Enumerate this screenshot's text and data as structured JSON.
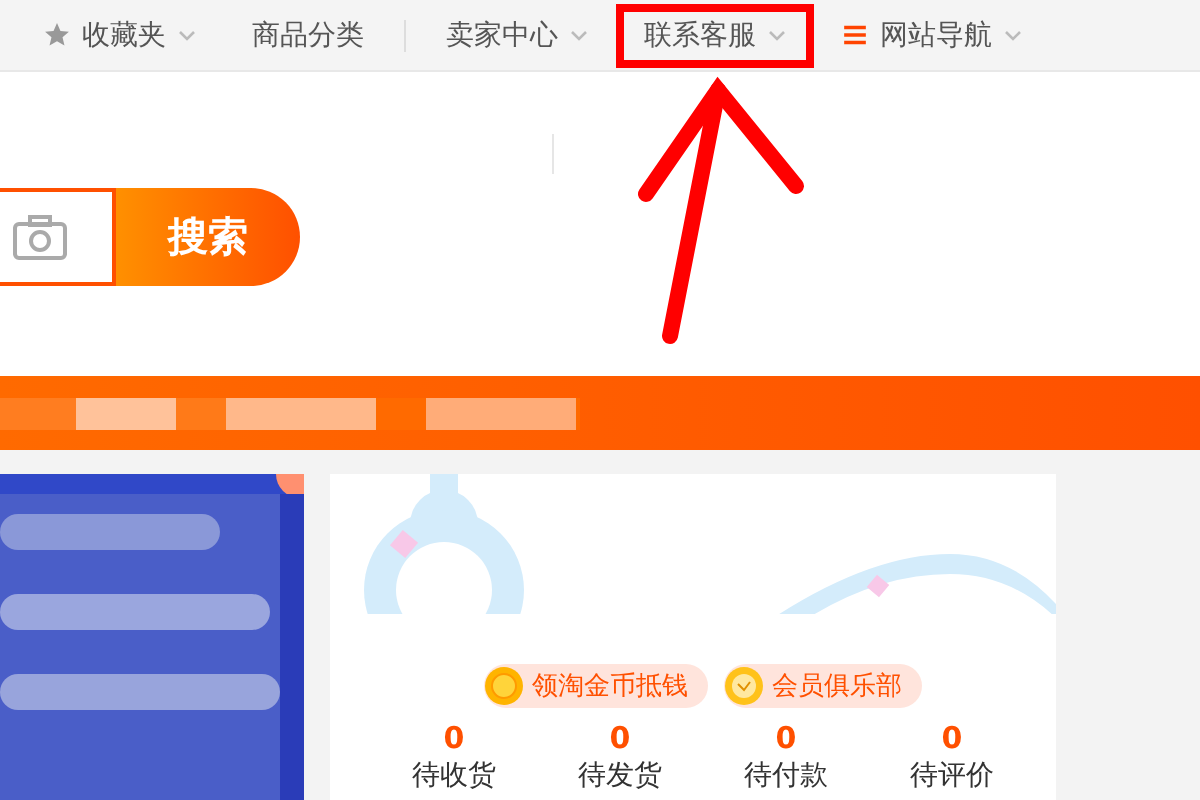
{
  "top_nav": [
    {
      "label": "收藏夹",
      "kind": "starred",
      "dropdown": true,
      "highlighted": false
    },
    {
      "label": "商品分类",
      "kind": "plain",
      "dropdown": false,
      "highlighted": false
    },
    {
      "kind": "divider"
    },
    {
      "label": "卖家中心",
      "kind": "plain",
      "dropdown": true,
      "highlighted": false
    },
    {
      "label": "联系客服",
      "kind": "plain",
      "dropdown": true,
      "highlighted": true
    },
    {
      "label": "网站导航",
      "kind": "menu",
      "dropdown": true,
      "highlighted": false
    }
  ],
  "search": {
    "button": "搜索"
  },
  "user_card": {
    "pills": [
      {
        "label": "领淘金币抵钱",
        "kind": "coin"
      },
      {
        "label": "会员俱乐部",
        "kind": "medal"
      }
    ],
    "stats": [
      {
        "count": "0",
        "label": "待收货"
      },
      {
        "count": "0",
        "label": "待发货"
      },
      {
        "count": "0",
        "label": "待付款"
      },
      {
        "count": "0",
        "label": "待评价"
      }
    ]
  }
}
